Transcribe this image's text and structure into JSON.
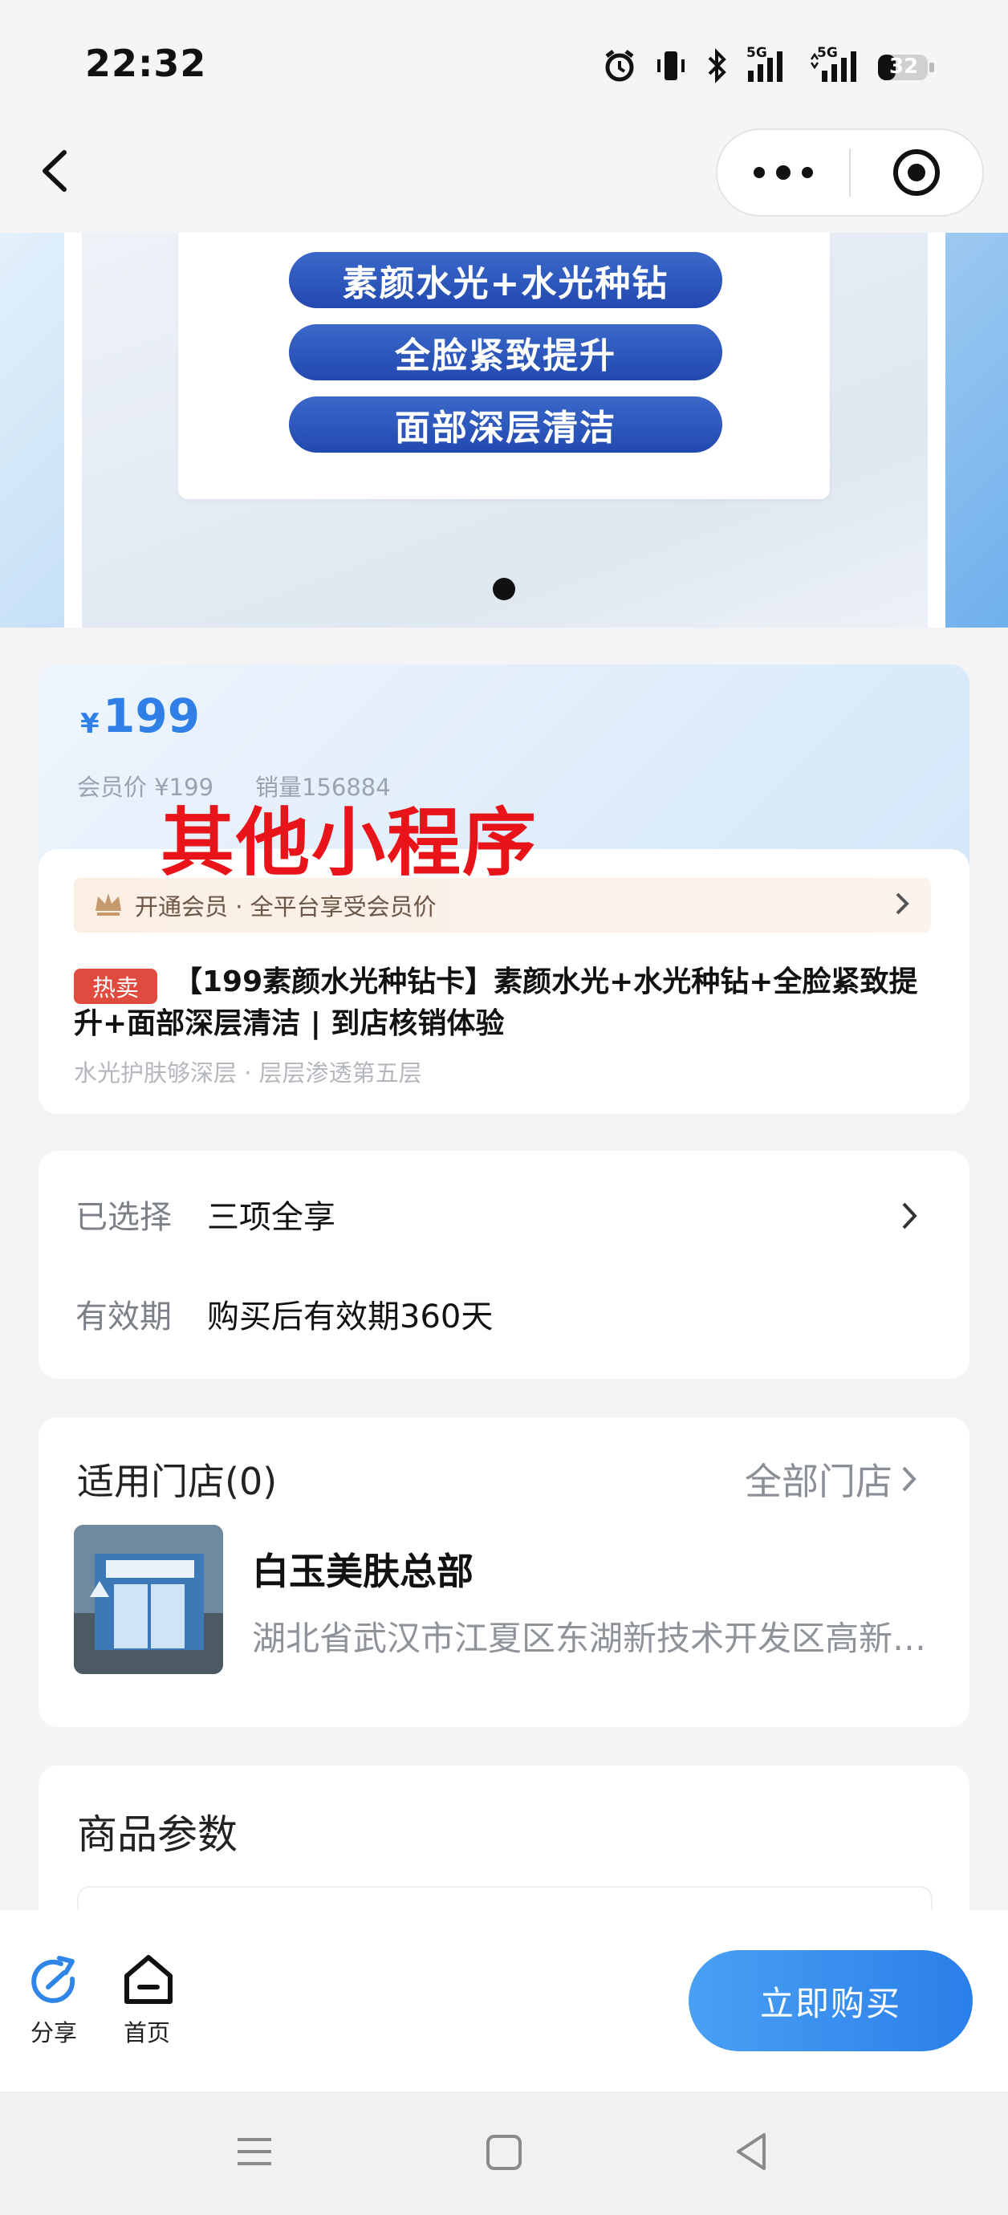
{
  "status_bar": {
    "time": "22:32",
    "battery": "32",
    "signal_1_label": "5G",
    "signal_2_label": "5G"
  },
  "banner": {
    "pills": [
      "素颜水光+水光种钻",
      "全脸紧致提升",
      "面部深层清洁"
    ],
    "current_slide": 1
  },
  "price": {
    "currency": "¥",
    "value": "199",
    "member_price": "会员价 ¥199",
    "sales": "销量156884"
  },
  "watermark": "其他小程序",
  "member_bar": {
    "text": "开通会员 · 全平台享受会员价"
  },
  "product": {
    "badge": "热卖",
    "title": "【199素颜水光种钻卡】素颜水光+水光种钻+全脸紧致提升+面部深层清洁 | 到店核销体验",
    "subtitle": "水光护肤够深层 · 层层渗透第五层"
  },
  "selection": {
    "selected_label": "已选择",
    "selected_value": "三项全享",
    "validity_label": "有效期",
    "validity_value": "购买后有效期360天"
  },
  "stores": {
    "title": "适用门店(0)",
    "all_label": "全部门店",
    "store_name": "白玉美肤总部",
    "store_address": "湖北省武汉市江夏区东湖新技术开发区高新大道"
  },
  "params": {
    "title": "商品参数"
  },
  "bottom_bar": {
    "share_label": "分享",
    "home_label": "首页",
    "buy_label": "立即购买"
  },
  "colors": {
    "accent": "#2f7fe6",
    "buy_button": "#3a8ff0",
    "hot_badge": "#e04a3f",
    "watermark": "#e8141a"
  }
}
